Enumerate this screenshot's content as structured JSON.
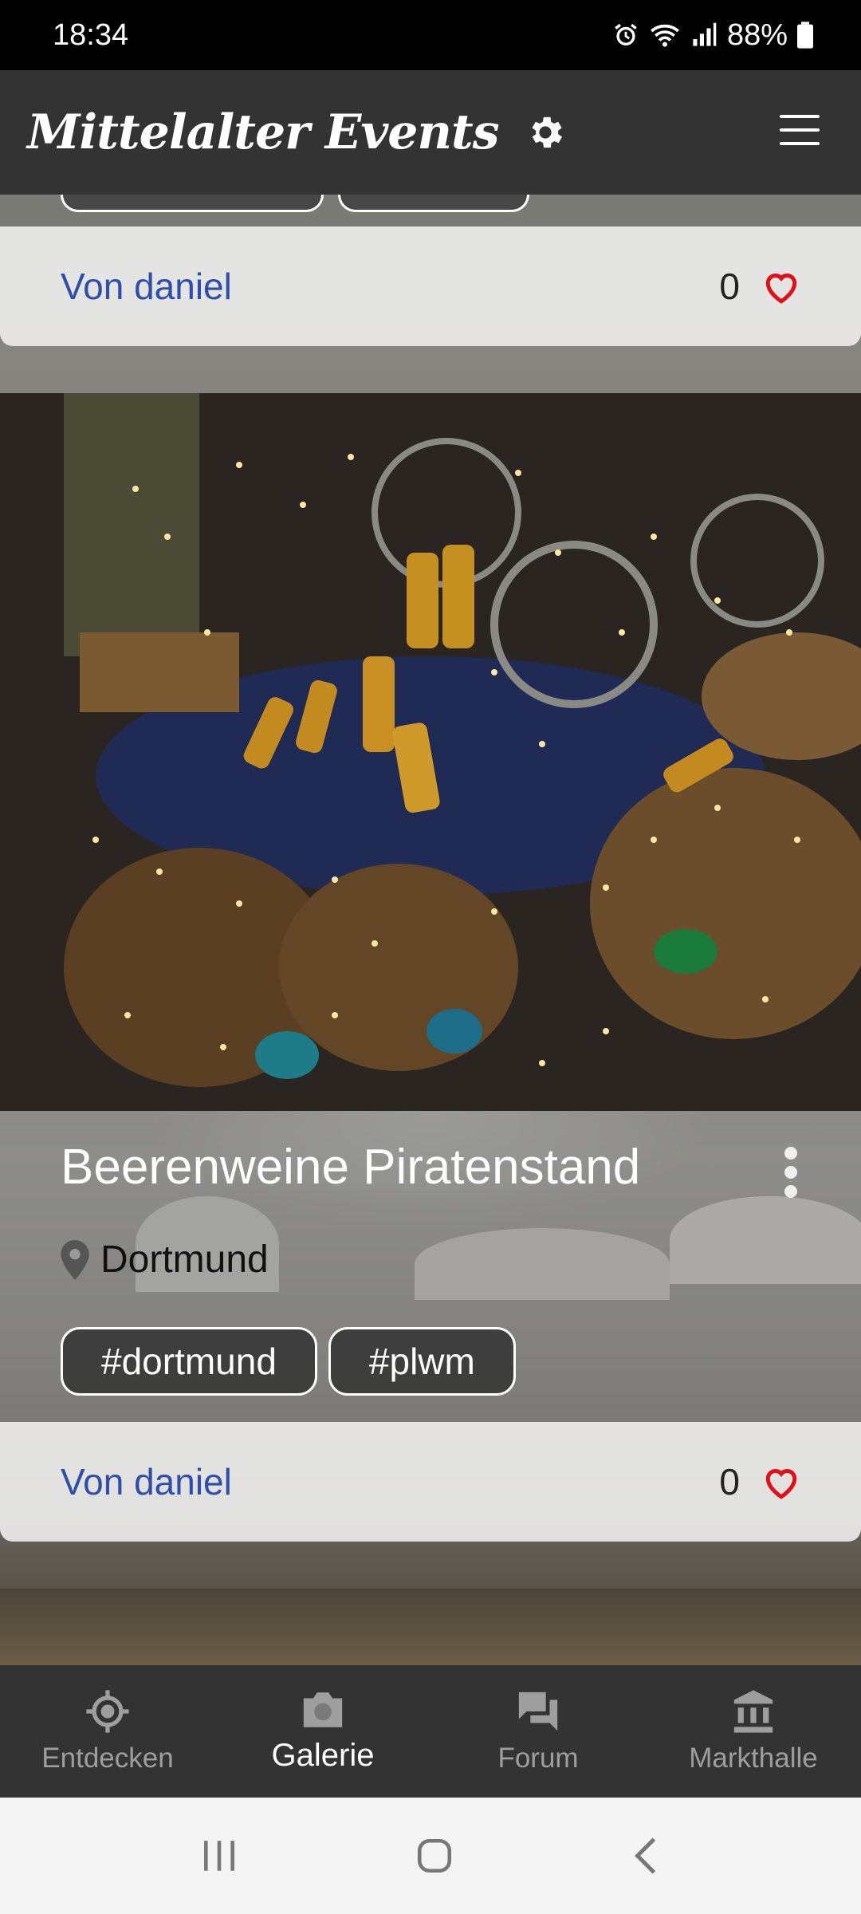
{
  "status_bar": {
    "time": "18:34",
    "battery": "88%"
  },
  "header": {
    "title": "Mittelalter Events",
    "settings_icon": "gear-icon",
    "menu_icon": "hamburger-menu-icon"
  },
  "previous_card": {
    "author": "Von daniel",
    "likes": "0"
  },
  "post": {
    "title": "Beerenweine Piratenstand",
    "location": "Dortmund",
    "tags": [
      "#dortmund",
      "#plwm"
    ],
    "author": "Von daniel",
    "likes": "0"
  },
  "nav": {
    "items": [
      {
        "label": "Entdecken",
        "icon": "crosshair-icon",
        "active": false
      },
      {
        "label": "Galerie",
        "icon": "camera-icon",
        "active": true
      },
      {
        "label": "Forum",
        "icon": "forum-icon",
        "active": false
      },
      {
        "label": "Markthalle",
        "icon": "bank-icon",
        "active": false
      }
    ]
  },
  "colors": {
    "accent_heart": "#e0101a",
    "link": "#2f4ea8",
    "header_bg": "#333333"
  }
}
